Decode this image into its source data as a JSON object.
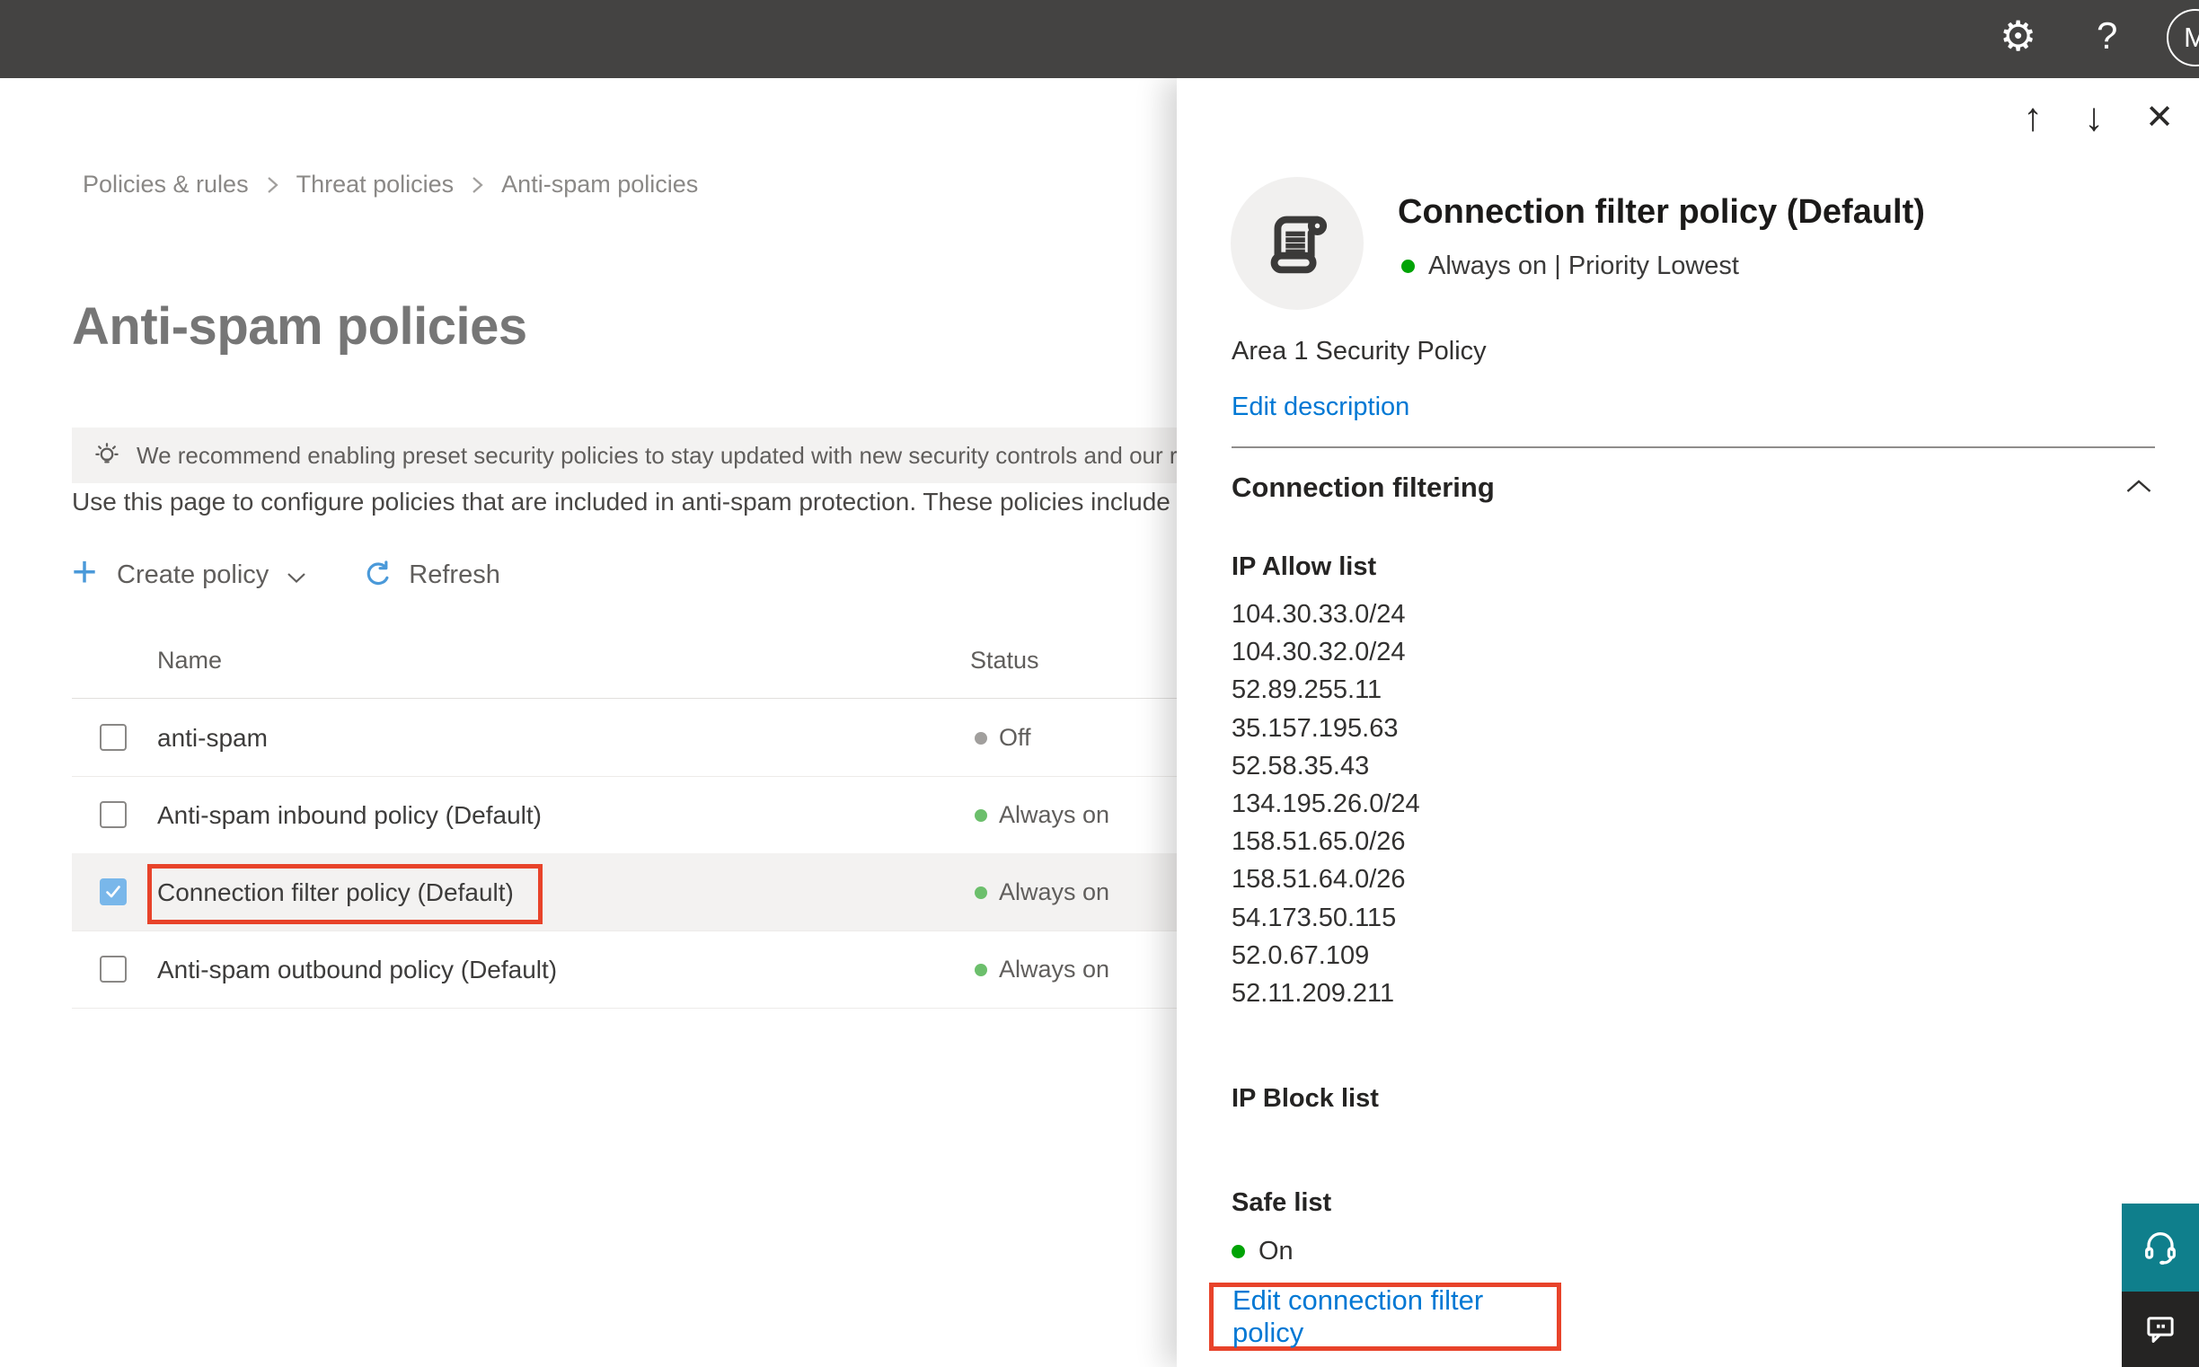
{
  "colors": {
    "topbar_bg": "#444342",
    "accent_blue": "#0078d4",
    "toolbar_blue": "#4a99d9",
    "status_green_row": "#6cbf6c",
    "status_green_panel": "#00a305",
    "status_gray_off": "#a19f9d",
    "checkbox_checked_blue": "#79b7ea",
    "highlight_red": "#e8432a",
    "help_teal": "#0f7f8c",
    "feedback_dark": "#252423"
  },
  "topbar": {
    "avatar_initial": "M"
  },
  "icons": {
    "settings": "⚙",
    "help": "?",
    "move_up": "↑",
    "move_down": "↓",
    "close": "✕",
    "plus": "+"
  },
  "breadcrumb": {
    "items": [
      "Policies & rules",
      "Threat policies",
      "Anti-spam policies"
    ]
  },
  "page": {
    "title": "Anti-spam policies",
    "banner_text": "We recommend enabling preset security policies to stay updated with new security controls and our recomme",
    "intro_text": "Use this page to configure policies that are included in anti-spam protection. These policies include",
    "toolbar": {
      "create_policy_label": "Create policy",
      "refresh_label": "Refresh"
    }
  },
  "table": {
    "columns": {
      "name": "Name",
      "status": "Status"
    },
    "rows": [
      {
        "name": "anti-spam",
        "status": "Off"
      },
      {
        "name": "Anti-spam inbound policy (Default)",
        "status": "Always on"
      },
      {
        "name": "Connection filter policy (Default)",
        "status": "Always on"
      },
      {
        "name": "Anti-spam outbound policy (Default)",
        "status": "Always on"
      }
    ]
  },
  "panel": {
    "title": "Connection filter policy (Default)",
    "status_line": "Always on | Priority Lowest",
    "description": "Area 1 Security Policy",
    "edit_description_label": "Edit description",
    "section_title": "Connection filtering",
    "ip_allow_title": "IP Allow list",
    "ip_allow_entries": [
      "104.30.33.0/24",
      "104.30.32.0/24",
      "52.89.255.11",
      "35.157.195.63",
      "52.58.35.43",
      "134.195.26.0/24",
      "158.51.65.0/26",
      "158.51.64.0/26",
      "54.173.50.115",
      "52.0.67.109",
      "52.11.209.211"
    ],
    "ip_block_title": "IP Block list",
    "safe_list_title": "Safe list",
    "safe_list_status": "On",
    "edit_policy_label": "Edit connection filter policy"
  }
}
